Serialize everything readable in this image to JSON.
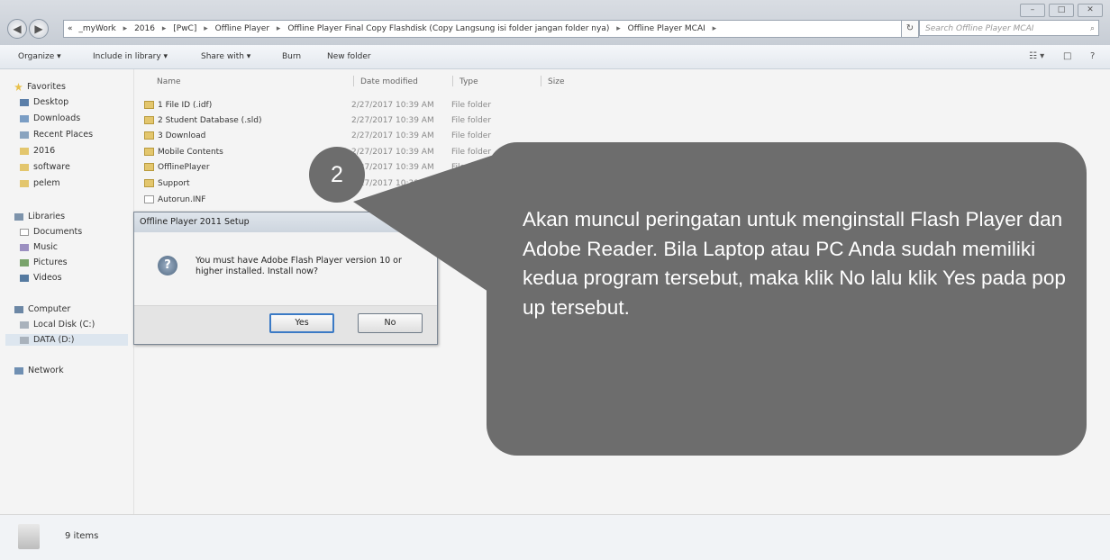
{
  "window": {
    "minimize_label": "–",
    "maximize_label": "□",
    "close_label": "✕",
    "back_label": "◀",
    "forward_label": "▶"
  },
  "address": {
    "overflow": "«",
    "crumbs": [
      "_myWork",
      "2016",
      "[PwC]",
      "Offline Player",
      "Offline Player Final Copy Flashdisk (Copy Langsung isi folder jangan folder nya)",
      "Offline Player MCAI"
    ],
    "separator": "▸",
    "refresh_label": "↻"
  },
  "search": {
    "placeholder": "Search Offline Player MCAI",
    "icon": "search-icon",
    "icon_glyph": "⌕"
  },
  "toolbar": {
    "organize": "Organize ▾",
    "include_in_library": "Include in library ▾",
    "share_with": "Share with ▾",
    "burn": "Burn",
    "new_folder": "New folder",
    "view_glyph": "☷ ▾",
    "pane_glyph": "□",
    "help_glyph": "?"
  },
  "sidebar": {
    "favorites": {
      "label": "Favorites",
      "items": [
        "Desktop",
        "Downloads",
        "Recent Places",
        "2016",
        "software",
        "pelem"
      ]
    },
    "libraries": {
      "label": "Libraries",
      "items": [
        "Documents",
        "Music",
        "Pictures",
        "Videos"
      ]
    },
    "computer": {
      "label": "Computer",
      "items": [
        "Local Disk (C:)",
        "DATA (D:)"
      ]
    },
    "network": {
      "label": "Network"
    }
  },
  "columns": {
    "name": "Name",
    "date": "Date modified",
    "type": "Type",
    "size": "Size"
  },
  "files": [
    {
      "name": "1 File ID (.idf)",
      "date": "2/27/2017 10:39 AM",
      "type": "File folder"
    },
    {
      "name": "2 Student Database (.sld)",
      "date": "2/27/2017 10:39 AM",
      "type": "File folder"
    },
    {
      "name": "3 Download",
      "date": "2/27/2017 10:39 AM",
      "type": "File folder"
    },
    {
      "name": "Mobile Contents",
      "date": "2/27/2017 10:39 AM",
      "type": "File folder"
    },
    {
      "name": "OfflinePlayer",
      "date": "2/27/2017 10:39 AM",
      "type": "File folder"
    },
    {
      "name": "Support",
      "date": "2/27/2017 10:39 AM",
      "type": "File folder"
    },
    {
      "name": "Autorun.INF",
      "date": "",
      "type": ""
    }
  ],
  "dialog": {
    "title": "Offline Player 2011 Setup",
    "icon": "question-icon",
    "icon_glyph": "?",
    "message": "You must have Adobe Flash Player version 10 or higher installed. Install now?",
    "yes_label": "Yes",
    "no_label": "No"
  },
  "status": {
    "items_count": "9 items"
  },
  "callout": {
    "step": "2",
    "text": "Akan muncul peringatan untuk menginstall Flash Player dan Adobe Reader. Bila Laptop atau PC Anda sudah memiliki kedua program tersebut, maka klik No lalu klik Yes pada pop up tersebut.",
    "color": "#6d6d6d"
  }
}
